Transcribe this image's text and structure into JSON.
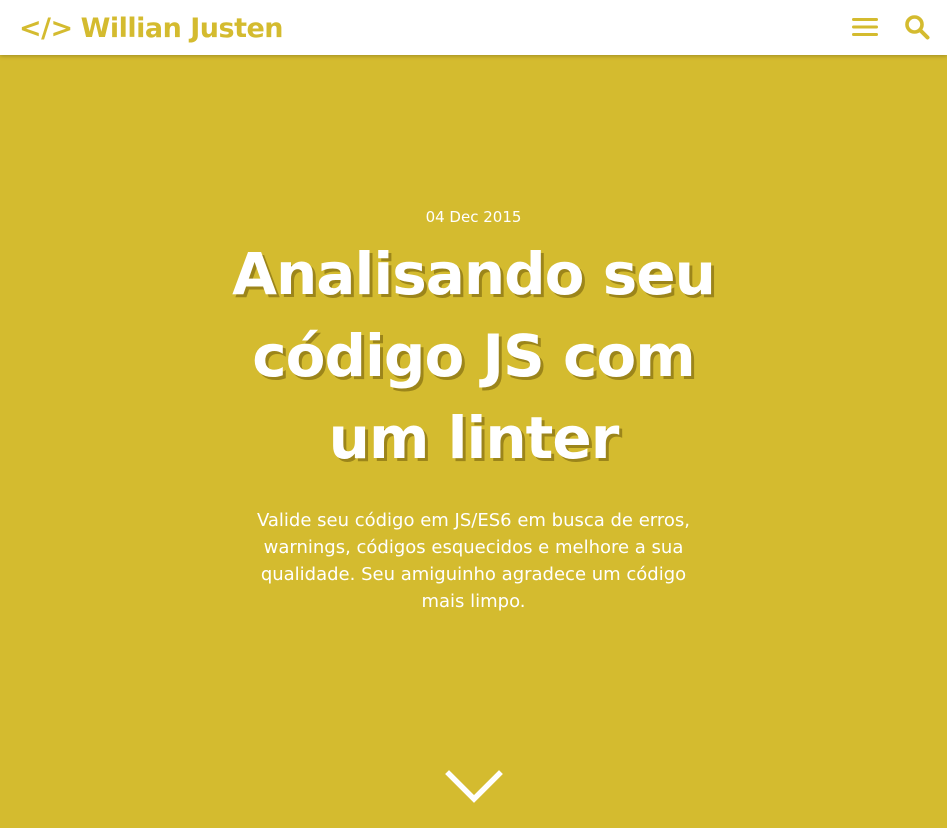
{
  "header": {
    "brand_mark": "</>",
    "brand_name": "Willian Justen",
    "menu_icon": "hamburger-menu-icon",
    "search_icon": "search-icon"
  },
  "post": {
    "date": "04 Dec 2015",
    "title": "Analisando seu código JS com um linter",
    "subtitle": "Valide seu código em JS/ES6 em busca de erros, warnings, códigos esquecidos e melhore a sua qualidade. Seu amiguinho agradece um código mais limpo.",
    "scroll_icon": "chevron-down-icon"
  },
  "colors": {
    "accent": "#d4bb2f",
    "header_bg": "#ffffff",
    "text_on_accent": "#ffffff"
  }
}
